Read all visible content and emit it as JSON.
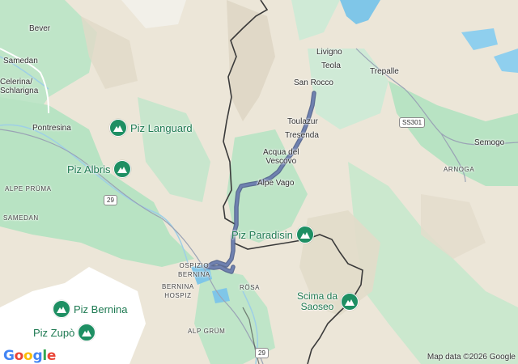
{
  "map": {
    "places": [
      {
        "id": "bever",
        "label": "Bever"
      },
      {
        "id": "samedan-top",
        "label": "Samedan"
      },
      {
        "id": "celerina",
        "label": "Celerina/\nSchlarigna"
      },
      {
        "id": "pontresina",
        "label": "Pontresina"
      },
      {
        "id": "alpe-pruma",
        "label": "ALPE PRÜMA"
      },
      {
        "id": "samedan-caps",
        "label": "SAMEDAN"
      },
      {
        "id": "ospizio",
        "label": "OSPIZIO\nBERNINA"
      },
      {
        "id": "bernina-hospiz",
        "label": "BERNINA\nHOSPIZ"
      },
      {
        "id": "rosa",
        "label": "RÖSA"
      },
      {
        "id": "alp-grum",
        "label": "ALP GRÜM"
      },
      {
        "id": "livigno",
        "label": "Livigno"
      },
      {
        "id": "teola",
        "label": "Teola"
      },
      {
        "id": "trepalle",
        "label": "Trepalle"
      },
      {
        "id": "san-rocco",
        "label": "San Rocco"
      },
      {
        "id": "toulazur",
        "label": "Toulazur"
      },
      {
        "id": "tresenda",
        "label": "Tresenda"
      },
      {
        "id": "acqua-del-vescovo",
        "label": "Acqua del\nVescovo"
      },
      {
        "id": "alpe-vago",
        "label": "Alpe Vago"
      },
      {
        "id": "semogo",
        "label": "Semogo"
      },
      {
        "id": "arnoga",
        "label": "ARNOGA"
      }
    ],
    "peaks": [
      {
        "id": "piz-languard",
        "label": "Piz Languard",
        "icon": "mountain-icon"
      },
      {
        "id": "piz-albris",
        "label": "Piz Albris",
        "icon": "mountain-icon"
      },
      {
        "id": "piz-paradisin",
        "label": "Piz Paradisin",
        "icon": "mountain-icon"
      },
      {
        "id": "piz-bernina",
        "label": "Piz Bernina",
        "icon": "mountain-icon"
      },
      {
        "id": "piz-zupo",
        "label": "Piz Zupò",
        "icon": "mountain-icon"
      },
      {
        "id": "scima-da-saoseo",
        "label": "Scima da\nSaoseo",
        "icon": "mountain-icon"
      }
    ],
    "road_shields": [
      {
        "id": "r29-a",
        "label": "29"
      },
      {
        "id": "r29-b",
        "label": "29"
      },
      {
        "id": "ss301",
        "label": "SS301"
      }
    ],
    "logo": "Google",
    "attribution": "Map data ©2026 Google",
    "colors": {
      "route": "#5c6f9c",
      "peak_pin": "#1e8f63",
      "peak_text": "#1e7a52",
      "water": "#7fc6e8",
      "forest": "#b8e3c3",
      "glacier": "#ffffff",
      "terrain": "#ece6d8",
      "border": "#3a3a3a"
    }
  }
}
